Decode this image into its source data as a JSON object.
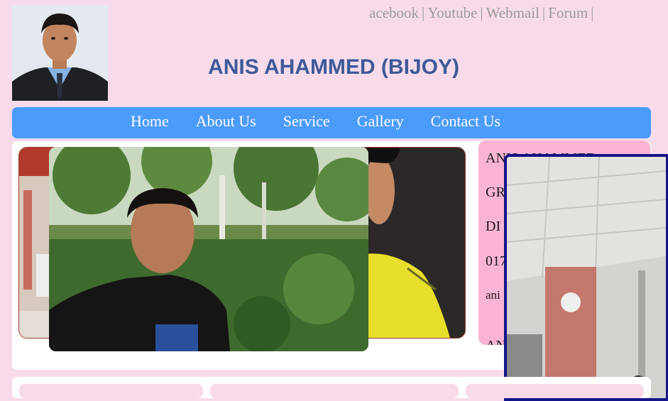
{
  "header": {
    "title": "ANIS AHAMMED (BIJOY)",
    "social_links": [
      {
        "label": "acebook"
      },
      {
        "label": "Youtube"
      },
      {
        "label": "Webmail"
      },
      {
        "label": "Forum"
      }
    ],
    "separator": "|"
  },
  "nav": {
    "items": [
      {
        "label": "Home"
      },
      {
        "label": "About Us"
      },
      {
        "label": "Service"
      },
      {
        "label": "Gallery"
      },
      {
        "label": "Contact Us"
      }
    ]
  },
  "info_card": {
    "lines": [
      "ANIS AHAMMED",
      "GR",
      "DI",
      "017",
      "ani",
      "AN"
    ]
  },
  "colors": {
    "page_bg": "#f8dbeb",
    "nav_bg": "#4b9bfb",
    "title": "#3d5a97",
    "info_card_bg": "#f9b4d3",
    "popup_border": "#14148a"
  }
}
